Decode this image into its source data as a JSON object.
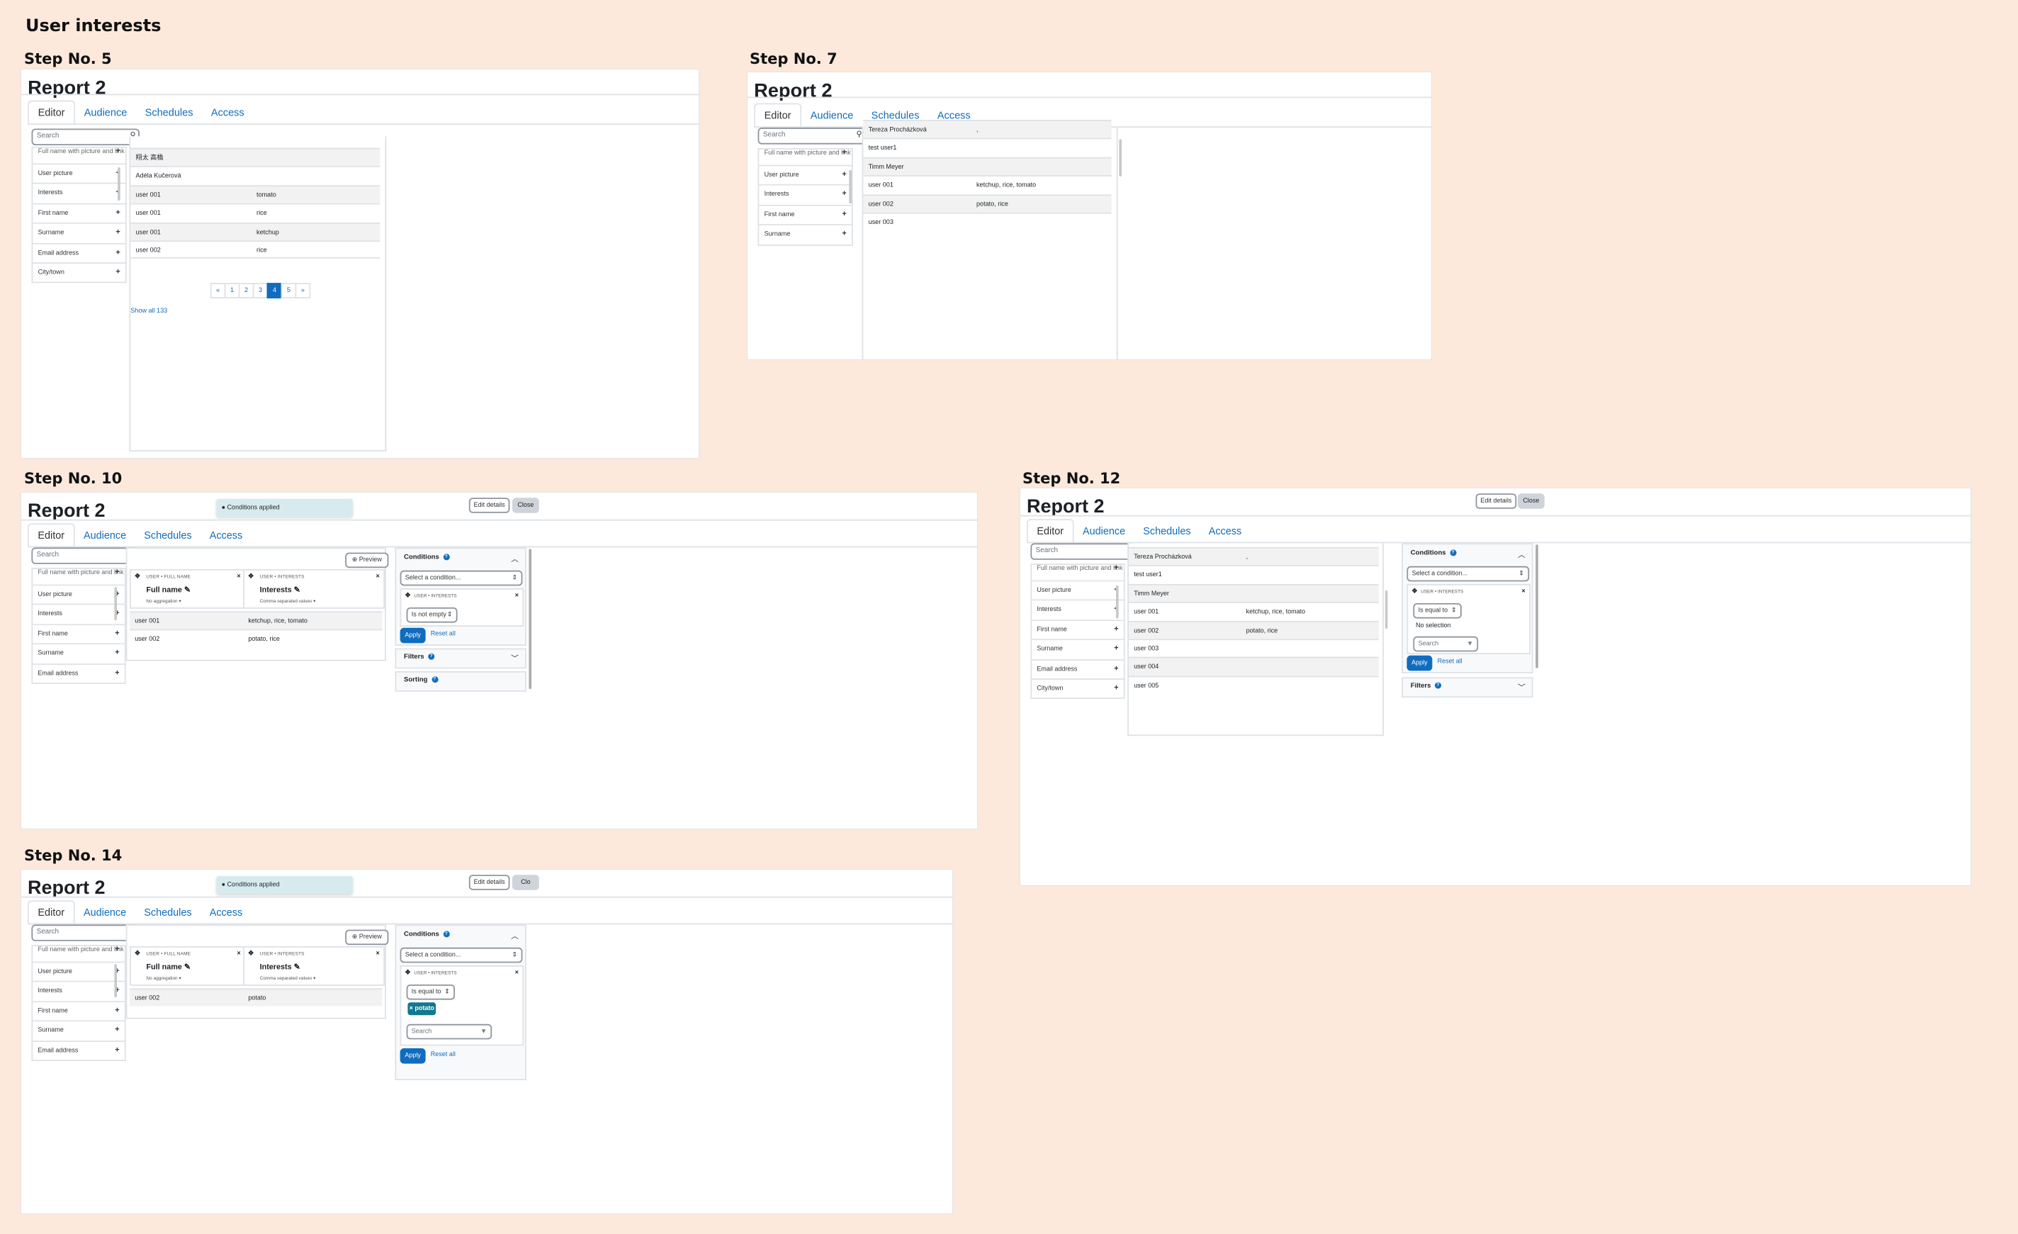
{
  "heading": "User interests",
  "steps": {
    "s5": "Step  No. 5",
    "s7": "Step  No. 7",
    "s10": "Step  No. 10",
    "s12": "Step  No. 12",
    "s14": "Step  No. 14"
  },
  "report": {
    "title": "Report 2",
    "tabs": [
      "Editor",
      "Audience",
      "Schedules",
      "Access"
    ],
    "edit_details": "Edit details",
    "close": "Close",
    "close_cut": "Clo"
  },
  "search": {
    "placeholder": "Search"
  },
  "sidebar": [
    "Full name with picture and link",
    "User picture",
    "Interests",
    "First name",
    "Surname",
    "Email address",
    "City/town"
  ],
  "step5": {
    "rows": [
      [
        "翔太 高橋",
        ""
      ],
      [
        "Adéla Kučerová",
        ""
      ],
      [
        "user 001",
        "tomato"
      ],
      [
        "user 001",
        "rice"
      ],
      [
        "user 001",
        "ketchup"
      ],
      [
        "user 002",
        "rice"
      ]
    ],
    "pages": [
      "«",
      "1",
      "2",
      "3",
      "4",
      "5",
      "»"
    ],
    "current_page": "4",
    "show_all": "Show all 133"
  },
  "step7": {
    "rows": [
      [
        "Tereza Procházková",
        ","
      ],
      [
        "test user1",
        ""
      ],
      [
        "Timm Meyer",
        ""
      ],
      [
        "user 001",
        "ketchup, rice, tomato"
      ],
      [
        "user 002",
        "potato, rice"
      ],
      [
        "user 003",
        ""
      ]
    ]
  },
  "step12": {
    "rows": [
      [
        "Tereza Procházková",
        ","
      ],
      [
        "test user1",
        ""
      ],
      [
        "Timm Meyer",
        ""
      ],
      [
        "user 001",
        "ketchup, rice, tomato"
      ],
      [
        "user 002",
        "potato, rice"
      ],
      [
        "user 003",
        ""
      ],
      [
        "user 004",
        ""
      ],
      [
        "user 005",
        ""
      ]
    ]
  },
  "toast": "Conditions applied",
  "preview": "Preview",
  "columns": {
    "full_path": "USER • FULL NAME",
    "full_name": "Full name",
    "full_agg": "No aggregation",
    "int_path": "USER • INTERESTS",
    "int_name": "Interests",
    "int_agg": "Comma separated values"
  },
  "step10": {
    "rows": [
      [
        "user 001",
        "ketchup, rice, tomato"
      ],
      [
        "user 002",
        "potato, rice"
      ]
    ]
  },
  "step14": {
    "rows": [
      [
        "user 002",
        "potato"
      ]
    ]
  },
  "conditions": {
    "title": "Conditions",
    "select": "Select a condition...",
    "card_path": "USER • INTERESTS",
    "not_empty": "Is not empty",
    "equal": "Is equal to",
    "no_selection": "No selection",
    "tag": "× potato",
    "apply": "Apply",
    "reset": "Reset all",
    "filters": "Filters",
    "sorting": "Sorting"
  }
}
